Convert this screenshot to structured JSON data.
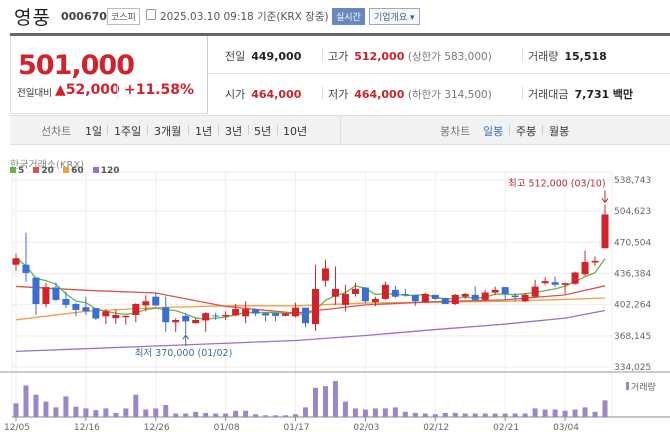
{
  "header": {
    "name": "영풍",
    "code": "000670",
    "market": "코스피",
    "datetime": "2025.03.10 09:18 기준(KRX 장중)",
    "realtime": "실시간",
    "company_info": "기업개요 ▾"
  },
  "quote": {
    "price": "501,000",
    "change_label": "전일대비",
    "change": "▲52,000",
    "change_pct": "+11.58%",
    "prev_label": "전일",
    "prev": "449,000",
    "high_label": "고가",
    "high": "512,000",
    "upper_limit": "(상한가 583,000)",
    "volume_label": "거래량",
    "volume": "15,518",
    "open_label": "시가",
    "open": "464,000",
    "low_label": "저가",
    "low": "464,000",
    "lower_limit": "(하한가 314,500)",
    "amount_label": "거래대금",
    "amount": "7,731",
    "amount_unit": "백만"
  },
  "tabs": {
    "line_chart": "선차트",
    "line_periods": [
      "1일",
      "1주일",
      "3개월",
      "1년",
      "3년",
      "5년",
      "10년"
    ],
    "candle_chart": "봉차트",
    "candle_periods": [
      "일봉",
      "주봉",
      "월봉"
    ],
    "active": "일봉"
  },
  "colors": {
    "up": "#d3222b",
    "down": "#3a6fd0",
    "ma5": "#6ab04c",
    "ma20": "#d9534f",
    "ma60": "#f0a040",
    "ma120": "#9b6fc9",
    "volume": "#9b86c9"
  },
  "chart_data": {
    "type": "candlestick",
    "source": "한국거래소(KRX)",
    "legend": [
      "5",
      "20",
      "60",
      "120"
    ],
    "yticks": [
      "538,743",
      "504,623",
      "470,504",
      "436,384",
      "402,264",
      "368,145",
      "334,025"
    ],
    "ylim": [
      334025,
      538743
    ],
    "xticks": [
      {
        "i": 0,
        "label": "12/05"
      },
      {
        "i": 7,
        "label": "12/16"
      },
      {
        "i": 14,
        "label": "12/26"
      },
      {
        "i": 21,
        "label": "01/08"
      },
      {
        "i": 28,
        "label": "01/17"
      },
      {
        "i": 35,
        "label": "02/03"
      },
      {
        "i": 42,
        "label": "02/12"
      },
      {
        "i": 49,
        "label": "02/21"
      },
      {
        "i": 55,
        "label": "03/04"
      }
    ],
    "high_annot": "최고 512,000 (03/10)",
    "low_annot": "최저 370,000 (01/02)",
    "high_index": 59,
    "low_index": 17,
    "high_value": 512000,
    "low_value": 370000,
    "volume_label": "거래량",
    "ohlc": [
      [
        446000,
        458000,
        439500,
        453000
      ],
      [
        446000,
        481000,
        427500,
        437000
      ],
      [
        432000,
        432000,
        391000,
        403000
      ],
      [
        403000,
        426000,
        399500,
        421500
      ],
      [
        421000,
        426500,
        406000,
        407500
      ],
      [
        408500,
        416700,
        398500,
        402000
      ],
      [
        403000,
        404000,
        389500,
        396500
      ],
      [
        399500,
        411000,
        391000,
        395000
      ],
      [
        398500,
        398500,
        385500,
        387000
      ],
      [
        389500,
        397400,
        381000,
        395000
      ],
      [
        387500,
        397400,
        381000,
        391000
      ],
      [
        388500,
        390100,
        380500,
        390100
      ],
      [
        391000,
        404000,
        383000,
        403000
      ],
      [
        401400,
        412500,
        395000,
        406000
      ],
      [
        411000,
        415000,
        400500,
        401400
      ],
      [
        399500,
        411000,
        372500,
        383000
      ],
      [
        383000,
        387500,
        372500,
        385500
      ],
      [
        390000,
        393000,
        370000,
        384000
      ],
      [
        382000,
        387500,
        381500,
        385500
      ],
      [
        385000,
        394000,
        372500,
        393000
      ],
      [
        390500,
        393500,
        385500,
        389500
      ],
      [
        389500,
        395000,
        385500,
        391000
      ],
      [
        390500,
        403000,
        389500,
        397500
      ],
      [
        389500,
        406000,
        382000,
        397500
      ],
      [
        397500,
        397500,
        389500,
        392500
      ],
      [
        393000,
        393000,
        384000,
        390500
      ],
      [
        393000,
        393000,
        384000,
        390000
      ],
      [
        390000,
        393000,
        389500,
        392500
      ],
      [
        389500,
        404500,
        388500,
        399000
      ],
      [
        399000,
        399000,
        377500,
        382000
      ],
      [
        381000,
        446000,
        373500,
        419500
      ],
      [
        428500,
        451500,
        422000,
        442000
      ],
      [
        411000,
        444000,
        402000,
        419500
      ],
      [
        402000,
        424000,
        395000,
        414000
      ],
      [
        414000,
        426500,
        411000,
        419500
      ],
      [
        421000,
        421500,
        404000,
        406000
      ],
      [
        405000,
        411000,
        400500,
        408500
      ],
      [
        408500,
        427500,
        407500,
        424000
      ],
      [
        418500,
        423000,
        409500,
        411000
      ],
      [
        414000,
        419500,
        411000,
        412500
      ],
      [
        413000,
        413000,
        401000,
        406000
      ],
      [
        405000,
        415500,
        404000,
        414000
      ],
      [
        413000,
        413000,
        407500,
        408500
      ],
      [
        409500,
        409500,
        403000,
        403000
      ],
      [
        403000,
        414000,
        402000,
        413000
      ],
      [
        411000,
        415000,
        408500,
        414000
      ],
      [
        413000,
        422000,
        406000,
        407500
      ],
      [
        407500,
        418500,
        406500,
        415500
      ],
      [
        415500,
        422000,
        413000,
        418500
      ],
      [
        421500,
        421500,
        407500,
        414000
      ],
      [
        412000,
        415000,
        406000,
        410500
      ],
      [
        406000,
        415000,
        404700,
        413000
      ],
      [
        411000,
        429500,
        410500,
        422000
      ],
      [
        425800,
        432400,
        424000,
        428000
      ],
      [
        426900,
        433100,
        421500,
        424000
      ],
      [
        424000,
        426500,
        414000,
        425800
      ],
      [
        425100,
        438500,
        424000,
        437500
      ],
      [
        435500,
        461500,
        433800,
        449000
      ],
      [
        448400,
        455000,
        444500,
        450200
      ],
      [
        464000,
        512000,
        464000,
        501000
      ]
    ],
    "volume": [
      12800,
      29400,
      20800,
      14400,
      9000,
      19200,
      9600,
      8000,
      6400,
      8000,
      3800,
      8000,
      20800,
      7000,
      8000,
      11200,
      3200,
      3200,
      4800,
      3800,
      3200,
      3200,
      5800,
      5800,
      2600,
      1600,
      1600,
      1600,
      2600,
      9000,
      27200,
      28800,
      33600,
      14400,
      8000,
      7000,
      8000,
      8000,
      9000,
      4800,
      3800,
      3200,
      2600,
      3800,
      3800,
      3200,
      3200,
      3200,
      3200,
      3200,
      3200,
      3200,
      8000,
      7000,
      7000,
      5800,
      7000,
      9000,
      4800,
      15518
    ],
    "ma20": [
      [
        0,
        422200
      ],
      [
        7,
        418000
      ],
      [
        14,
        415000
      ],
      [
        21,
        400300
      ],
      [
        28,
        393000
      ],
      [
        31,
        397000
      ],
      [
        35,
        402000
      ],
      [
        42,
        405500
      ],
      [
        49,
        407500
      ],
      [
        55,
        413000
      ],
      [
        59,
        422900
      ]
    ],
    "ma60": [
      [
        0,
        385700
      ],
      [
        7,
        395000
      ],
      [
        14,
        399000
      ],
      [
        21,
        401000
      ],
      [
        28,
        401000
      ],
      [
        35,
        404000
      ],
      [
        42,
        405000
      ],
      [
        49,
        406000
      ],
      [
        55,
        408000
      ],
      [
        59,
        409600
      ]
    ],
    "ma120": [
      [
        0,
        351100
      ],
      [
        14,
        357000
      ],
      [
        28,
        363000
      ],
      [
        35,
        368500
      ],
      [
        42,
        375000
      ],
      [
        49,
        381000
      ],
      [
        55,
        387500
      ],
      [
        59,
        395900
      ]
    ]
  }
}
